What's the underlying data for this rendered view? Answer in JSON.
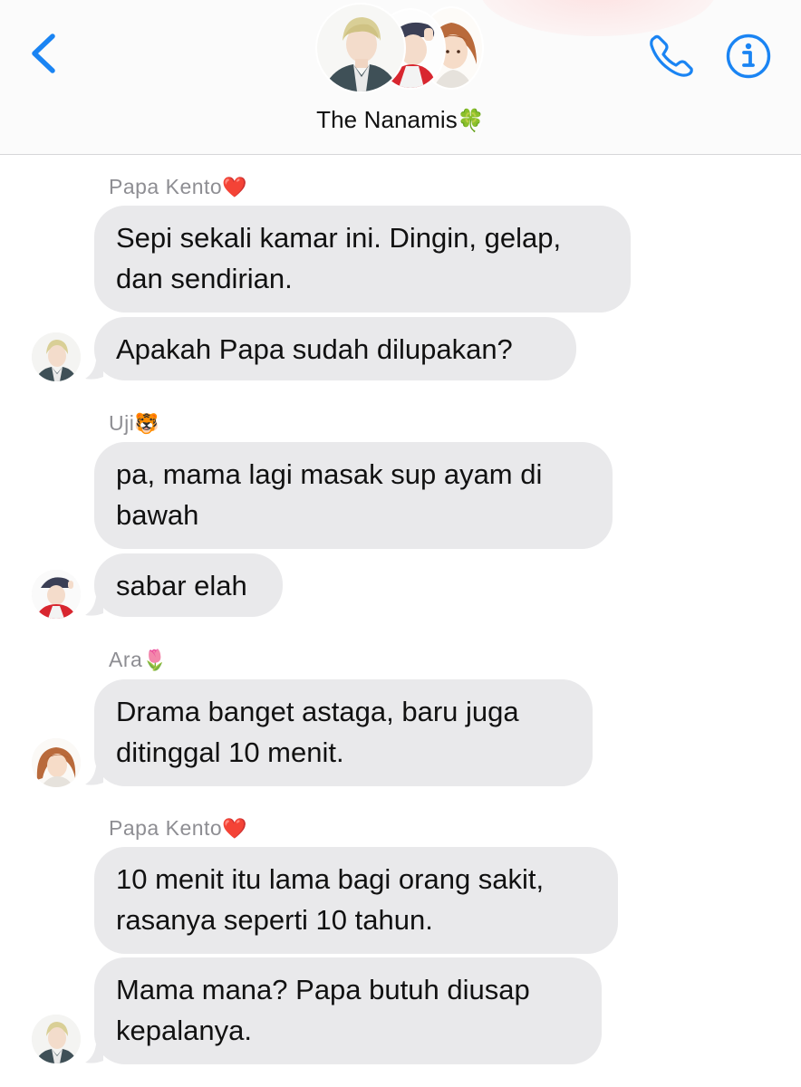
{
  "header": {
    "title": "The Nanamis",
    "title_emoji": "🍀",
    "back_icon": "chevron-left-icon",
    "call_icon": "phone-icon",
    "info_icon": "info-icon",
    "accent_color": "#1a84f3"
  },
  "messages": [
    {
      "sender": "Papa Kento",
      "sender_emoji": "❤️",
      "bubbles": [
        "Sepi sekali kamar ini. Dingin, gelap,\ndan sendirian.",
        "Apakah Papa sudah dilupakan?"
      ]
    },
    {
      "sender": "Uji",
      "sender_emoji": "🐯",
      "bubbles": [
        "pa, mama lagi masak sup ayam di\nbawah",
        "sabar elah"
      ]
    },
    {
      "sender": "Ara",
      "sender_emoji": "🌷",
      "bubbles": [
        "Drama banget astaga, baru juga\nditinggal 10 menit."
      ]
    },
    {
      "sender": "Papa Kento",
      "sender_emoji": "❤️",
      "bubbles": [
        "10 menit itu lama bagi orang sakit,\nrasanya seperti 10 tahun.",
        "Mama mana? Papa butuh diusap\nkepalanya."
      ]
    }
  ],
  "colors": {
    "bubble_bg": "#e9e9eb",
    "sender_text": "#8e8e93",
    "header_bg": "#fbfbfb"
  }
}
